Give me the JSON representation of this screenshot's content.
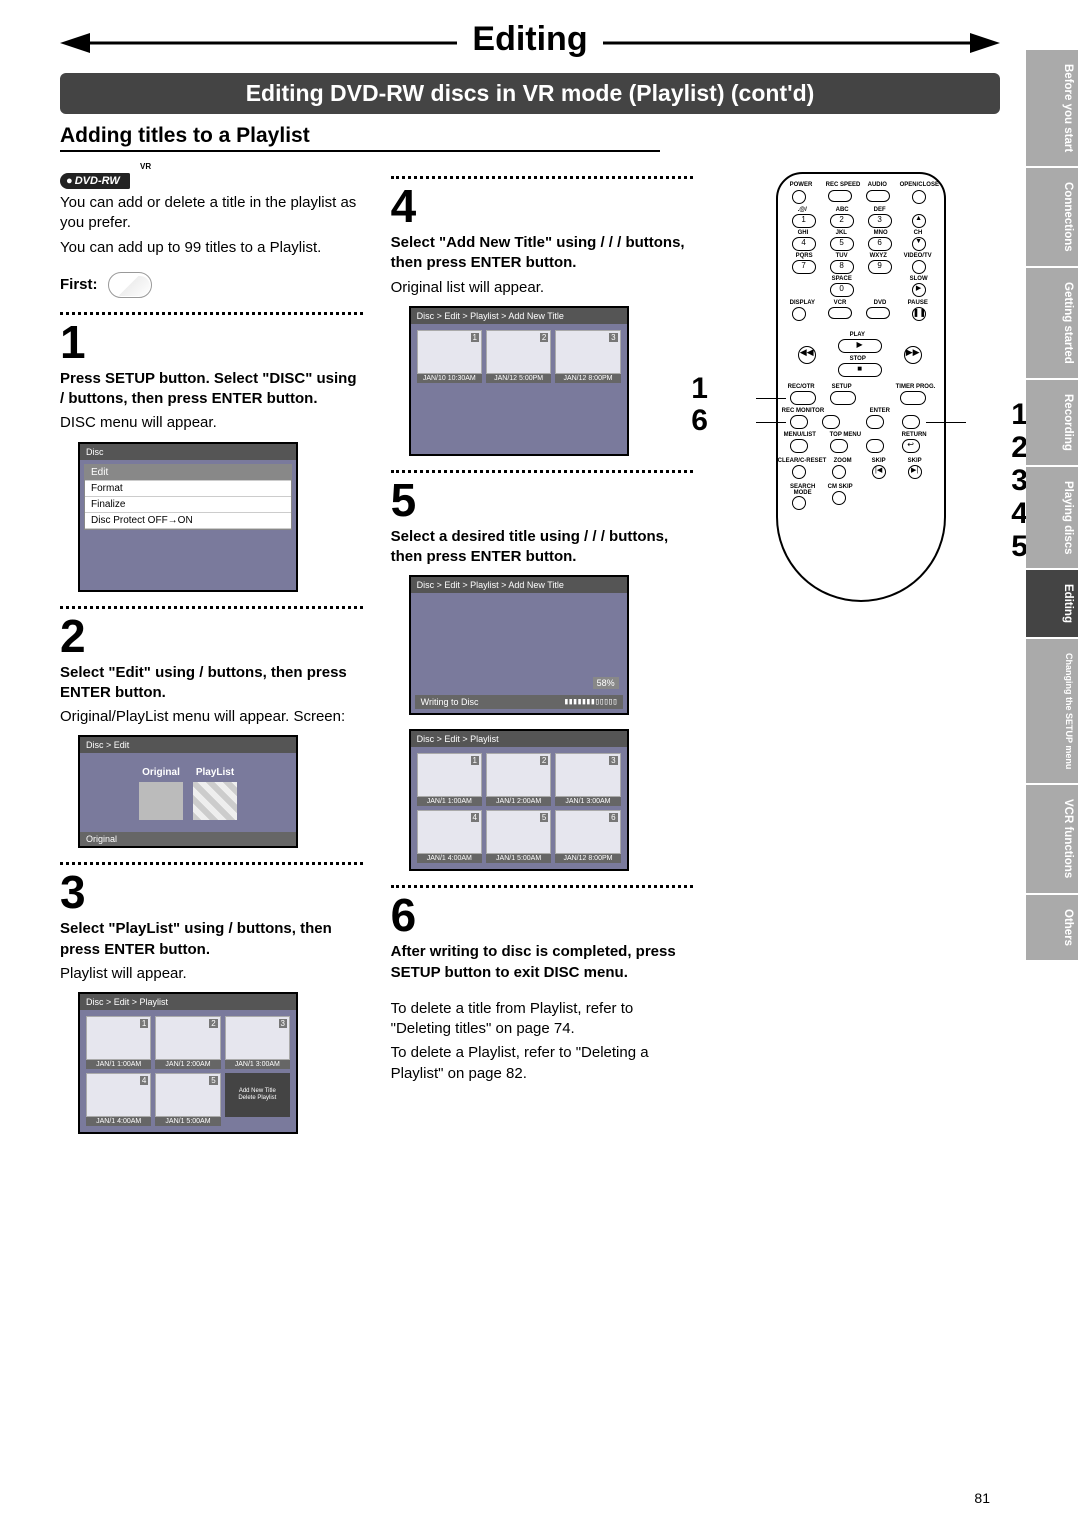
{
  "page_number": "81",
  "title": "Editing",
  "sub_banner": "Editing DVD-RW discs in VR mode (Playlist) (cont'd)",
  "section_title": "Adding titles to a Playlist",
  "badge_vr": "VR",
  "badge_dvdrw": "DVD-RW",
  "intro1": "You can add or delete a title in the playlist as you prefer.",
  "intro2": "You can add up to 99 titles to a Playlist.",
  "first_label": "First:",
  "steps": {
    "s1": {
      "num": "1",
      "head": "Press SETUP button. Select \"DISC\" using    /    buttons, then press ENTER button.",
      "body": "DISC menu will appear.",
      "screen": {
        "bread": "Disc",
        "items": [
          "Edit",
          "Format",
          "Finalize",
          "Disc Protect OFF→ON"
        ]
      }
    },
    "s2": {
      "num": "2",
      "head": "Select \"Edit\" using    /    buttons, then press ENTER button.",
      "body": "Original/PlayList menu will appear. Screen:",
      "screen": {
        "bread": "Disc > Edit",
        "opt1": "Original",
        "opt2": "PlayList",
        "caption": "Original"
      }
    },
    "s3": {
      "num": "3",
      "head": "Select \"PlayList\" using    / buttons, then press ENTER button.",
      "body": "Playlist will appear.",
      "screen": {
        "bread": "Disc > Edit > Playlist",
        "thumbs": [
          "JAN/1  1:00AM",
          "JAN/1  2:00AM",
          "JAN/1  3:00AM",
          "JAN/1  4:00AM",
          "JAN/1  5:00AM"
        ],
        "add_new_title": "Add  New Title",
        "delete_playlist": "Delete Playlist"
      }
    },
    "s4": {
      "num": "4",
      "head": "Select \"Add New Title\" using    /    /    /    buttons, then press ENTER button.",
      "body": "Original list will appear.",
      "screen": {
        "bread": "Disc > Edit > Playlist > Add New Title",
        "thumbs": [
          "JAN/10 10:30AM",
          "JAN/12  5:00PM",
          "JAN/12  8:00PM"
        ]
      }
    },
    "s5": {
      "num": "5",
      "head": "Select a desired title using    /    /    /    buttons, then press ENTER button.",
      "screenA": {
        "bread": "Disc > Edit > Playlist > Add New Title",
        "progress_pct": "58%",
        "writing": "Writing to Disc"
      },
      "screenB": {
        "bread": "Disc > Edit > Playlist",
        "thumbs": [
          "JAN/1  1:00AM",
          "JAN/1  2:00AM",
          "JAN/1  3:00AM",
          "JAN/1  4:00AM",
          "JAN/1  5:00AM",
          "JAN/12  8:00PM"
        ]
      }
    },
    "s6": {
      "num": "6",
      "head": "After writing to disc is completed, press SETUP button to exit DISC menu.",
      "body1": "To delete a title from Playlist, refer to \"Deleting titles\" on page 74.",
      "body2": "To delete a Playlist, refer to \"Deleting a Playlist\" on page 82."
    }
  },
  "remote": {
    "labels_row1": [
      "POWER",
      "REC SPEED",
      "AUDIO",
      "OPEN/CLOSE"
    ],
    "labels_row2": [
      ".@/",
      "ABC",
      "DEF"
    ],
    "nums_row2": [
      "1",
      "2",
      "3"
    ],
    "labels_row3": [
      "GHI",
      "JKL",
      "MNO",
      "CH"
    ],
    "nums_row3": [
      "4",
      "5",
      "6"
    ],
    "labels_row4": [
      "PQRS",
      "TUV",
      "WXYZ",
      "VIDEO/TV"
    ],
    "nums_row4": [
      "7",
      "8",
      "9"
    ],
    "labels_row5": [
      "SPACE",
      "SLOW"
    ],
    "nums_row5": [
      "0"
    ],
    "labels_row6": [
      "DISPLAY",
      "VCR",
      "DVD",
      "PAUSE"
    ],
    "play": "PLAY",
    "stop": "STOP",
    "labels_row7": [
      "REC/OTR",
      "SETUP",
      "TIMER PROG."
    ],
    "labels_row8": [
      "REC MONITOR",
      "ENTER"
    ],
    "labels_row9": [
      "MENU/LIST",
      "TOP MENU",
      "RETURN"
    ],
    "labels_row10": [
      "CLEAR/C-RESET",
      "ZOOM",
      "SKIP",
      "SKIP"
    ],
    "labels_row11": [
      "SEARCH MODE",
      "CM SKIP"
    ],
    "left_nums": [
      "1",
      "6"
    ],
    "right_nums": [
      "1",
      "2",
      "3",
      "4",
      "5"
    ]
  },
  "tabs": [
    "Before you start",
    "Connections",
    "Getting started",
    "Recording",
    "Playing discs",
    "Editing",
    "Changing the SETUP menu",
    "VCR functions",
    "Others"
  ]
}
